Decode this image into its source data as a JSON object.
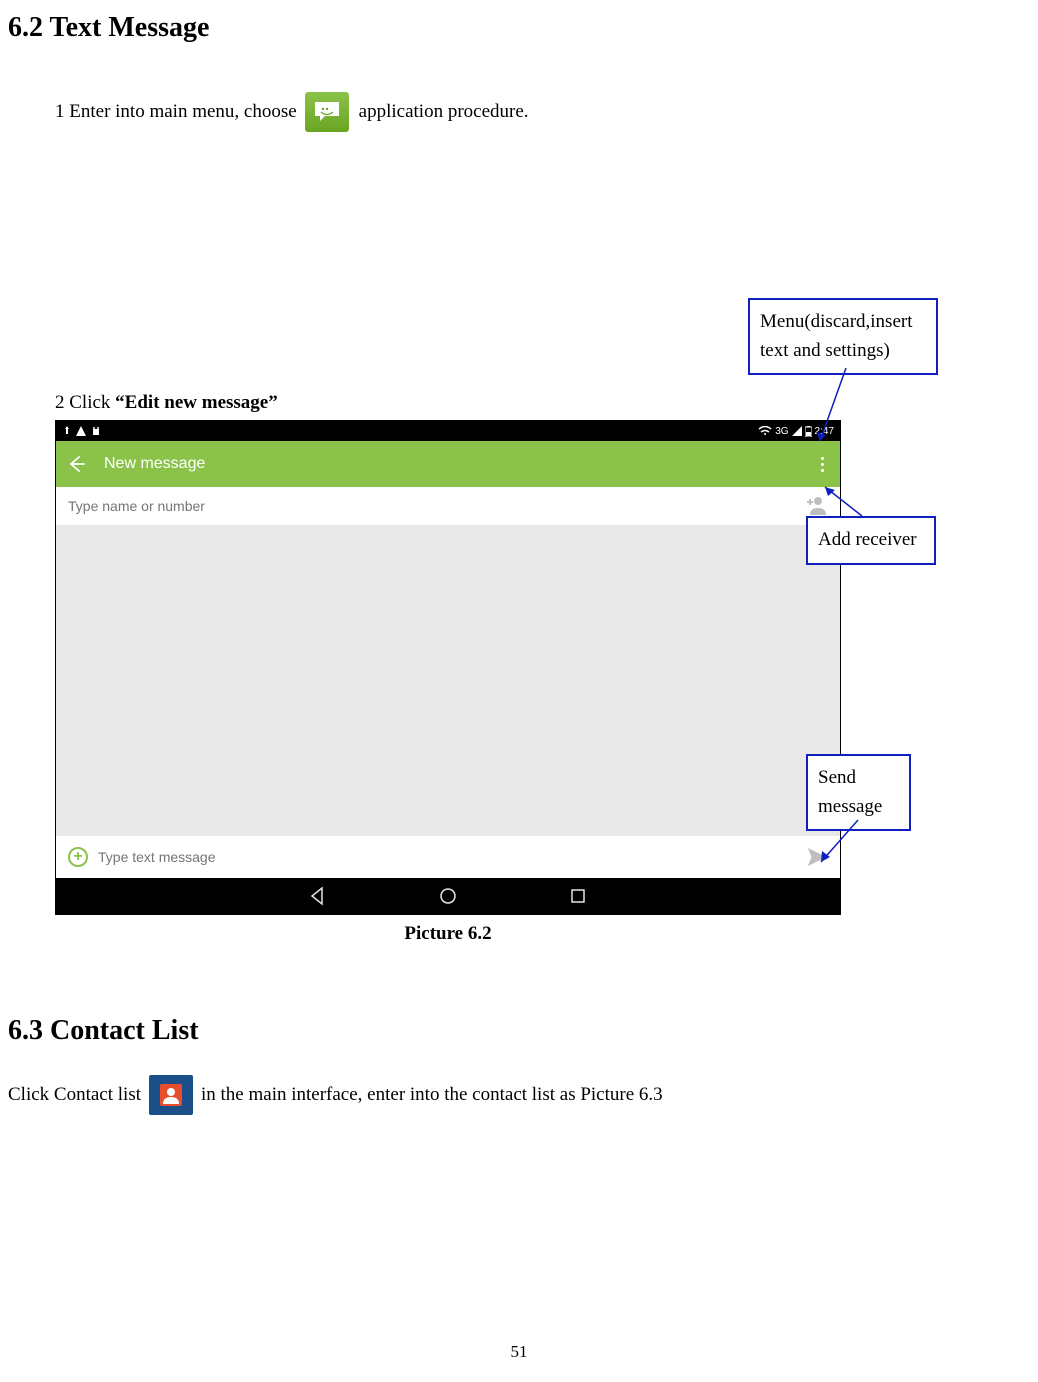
{
  "section62_title": "6.2 Text Message",
  "step1_pre": "1 Enter into main menu, choose",
  "step1_post": "application procedure.",
  "step2_pre": "2 Click ",
  "step2_bold": "“Edit new message”",
  "callouts": {
    "menu": "Menu(discard,insert text and settings)",
    "add_receiver": "Add receiver",
    "send": "Send message"
  },
  "screenshot": {
    "status": {
      "time": "2:47",
      "signal": "3G"
    },
    "app_title": "New message",
    "recipient_placeholder": "Type name or number",
    "compose_placeholder": "Type text message"
  },
  "caption": "Picture 6.2",
  "section63_title": "6.3 Contact List",
  "contact_pre": "Click Contact list",
  "contact_post": "in the main interface, enter into the contact list as Picture 6.3",
  "page_number": "51"
}
